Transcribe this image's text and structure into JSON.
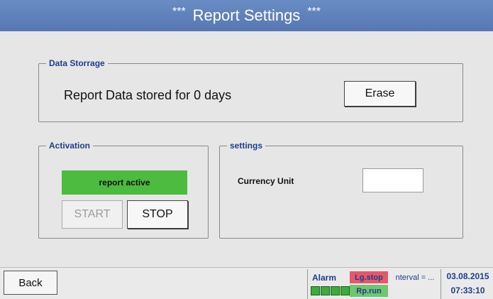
{
  "title": {
    "stars_left": "***",
    "text": "Report Settings",
    "stars_right": "***"
  },
  "data_storage": {
    "legend": "Data Storrage",
    "status_text": "Report Data stored for 0 days",
    "erase_label": "Erase"
  },
  "activation": {
    "legend": "Activation",
    "status": "report active",
    "start_label": "START",
    "stop_label": "STOP"
  },
  "settings": {
    "legend": "settings",
    "currency_label": "Currency Unit",
    "currency_value": ""
  },
  "footer": {
    "back_label": "Back",
    "alarm_label": "Alarm",
    "lg_stop": "Lg.stop",
    "rp_run": "Rp.run",
    "interval": "nterval = ...",
    "date": "03.08.2015",
    "time": "07:33:10"
  },
  "colors": {
    "titlebar": "#5a7bb8",
    "report_active": "#4cbb3f",
    "lg_stop_bg": "#e5586a",
    "rp_run_bg": "#6fc76f",
    "accent_text": "#1f3d8c"
  }
}
